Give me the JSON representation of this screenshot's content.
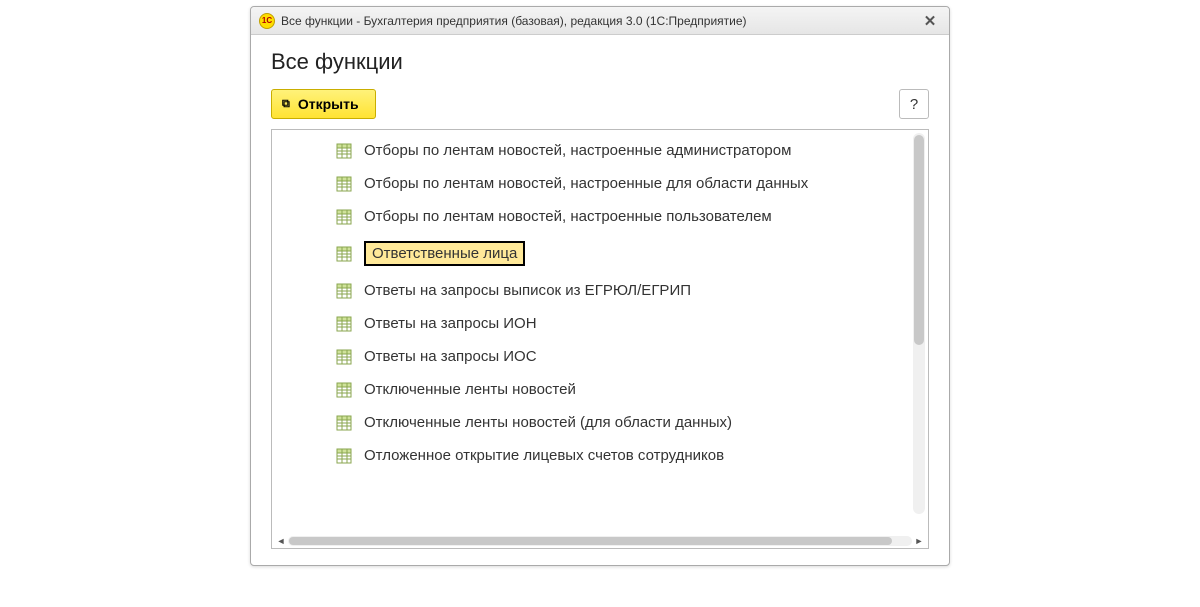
{
  "window": {
    "title": "Все функции - Бухгалтерия предприятия (базовая), редакция 3.0  (1С:Предприятие)",
    "appIconText": "1C"
  },
  "page": {
    "title": "Все функции"
  },
  "toolbar": {
    "openLabel": "Открыть",
    "helpLabel": "?"
  },
  "list": {
    "highlightedIndex": 3,
    "items": [
      {
        "label": "Отборы по лентам новостей, настроенные администратором"
      },
      {
        "label": "Отборы по лентам новостей, настроенные для области данных"
      },
      {
        "label": "Отборы по лентам новостей, настроенные пользователем"
      },
      {
        "label": "Ответственные лица"
      },
      {
        "label": "Ответы на запросы выписок из ЕГРЮЛ/ЕГРИП"
      },
      {
        "label": "Ответы на запросы ИОН"
      },
      {
        "label": "Ответы на запросы ИОС"
      },
      {
        "label": "Отключенные ленты новостей"
      },
      {
        "label": "Отключенные ленты новостей (для области данных)"
      },
      {
        "label": "Отложенное открытие лицевых счетов сотрудников"
      }
    ]
  }
}
